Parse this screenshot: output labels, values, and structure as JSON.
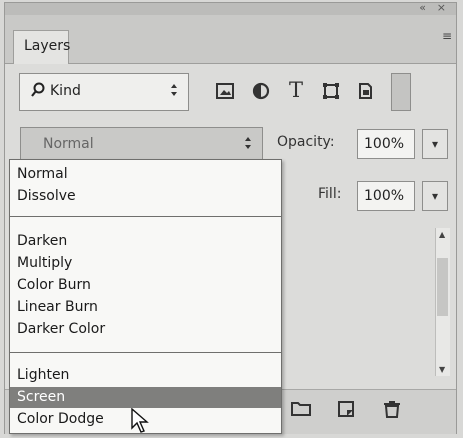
{
  "panel": {
    "tab_label": "Layers",
    "collapse_glyph": "«",
    "close_glyph": "×",
    "menu_glyph": "≡"
  },
  "filter": {
    "label": "Kind",
    "arrows": "♦",
    "icons": [
      "image-filter-icon",
      "adjustment-filter-icon",
      "type-filter-icon",
      "shape-filter-icon",
      "smart-object-filter-icon"
    ]
  },
  "blend_mode": {
    "value": "Normal",
    "arrows": "♦"
  },
  "opacity": {
    "label": "Opacity:",
    "value": "100%"
  },
  "fill": {
    "label": "Fill:",
    "value": "100%"
  },
  "dropdown_arrow": "▾",
  "blend_menu": {
    "groups": [
      [
        "Normal",
        "Dissolve"
      ],
      [
        "Darken",
        "Multiply",
        "Color Burn",
        "Linear Burn",
        "Darker Color"
      ],
      [
        "Lighten",
        "Screen",
        "Color Dodge"
      ]
    ],
    "highlighted": "Screen"
  },
  "colors": {
    "panel_bg": "#dcdcda",
    "menu_highlight": "#7f7f7d"
  }
}
